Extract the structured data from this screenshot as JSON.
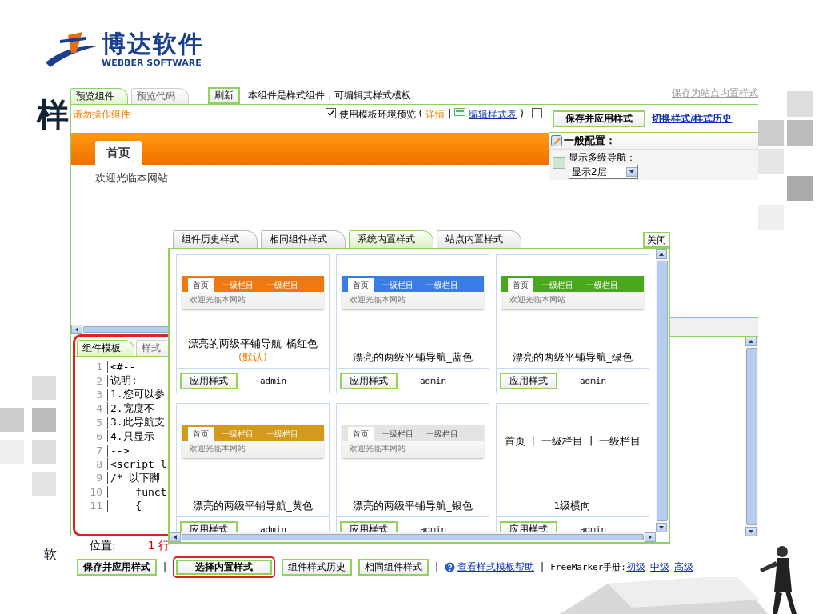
{
  "slide": {
    "logo": {
      "name": "博达软件",
      "subtitle": "WEBBER SOFTWARE"
    },
    "title": "样",
    "footer": "软"
  },
  "editor_window": {
    "tabs": [
      {
        "label": "预览组件",
        "selected": true
      },
      {
        "label": "预览代码",
        "selected": false
      }
    ],
    "refresh": "刷新",
    "notice": "本组件是样式组件，可编辑其样式模板",
    "save_site_link": "保存为站点内置样式",
    "warning": "请勿操作组件",
    "env_preview": {
      "checked": true,
      "label": "使用模板环境预览",
      "paren_open": "(",
      "details": "详情",
      "separator": "|",
      "edit_css": "编辑样式表",
      "paren_close": ")"
    },
    "extra_checkbox": {
      "checked": false
    },
    "save_apply": "保存并应用样式",
    "switch_link": "切换样式/样式历史",
    "preview": {
      "nav_items": [
        {
          "label": "首页",
          "selected": true
        }
      ],
      "welcome": "欢迎光临本网站"
    },
    "config": {
      "title": "一般配置：",
      "field_label": "显示多级导航：",
      "select_value": "显示2层"
    },
    "code_tabs": [
      {
        "label": "组件模板",
        "selected": true
      },
      {
        "label": "样式",
        "selected": false
      }
    ],
    "code_lines": [
      {
        "number": "1",
        "text": "<#--"
      },
      {
        "number": "2",
        "text": "说明:"
      },
      {
        "number": "3",
        "text": "1.您可以参"
      },
      {
        "number": "4",
        "text": "2.宽度不"
      },
      {
        "number": "5",
        "text": "3.此导航支"
      },
      {
        "number": "6",
        "text": "4.只显示"
      },
      {
        "number": "7",
        "text": "-->"
      },
      {
        "number": "8",
        "text": "<script l"
      },
      {
        "number": "9",
        "text": "/* 以下脚"
      },
      {
        "number": "10",
        "text": "    funct"
      },
      {
        "number": "11",
        "text": "    {"
      }
    ],
    "position": {
      "label": "位置:",
      "value": "1 行"
    },
    "toolbar": [
      {
        "kind": "button",
        "label": "保存并应用样式",
        "bold": true,
        "highlighted": false
      },
      {
        "kind": "separator",
        "label": "|"
      },
      {
        "kind": "button",
        "label": "选择内置样式",
        "bold": true,
        "highlighted": true
      },
      {
        "kind": "button",
        "label": "组件样式历史",
        "bold": false,
        "highlighted": false
      },
      {
        "kind": "button",
        "label": "相同组件样式",
        "bold": false,
        "highlighted": false
      },
      {
        "kind": "separator",
        "label": "|"
      },
      {
        "kind": "help",
        "label": "查看样式模板帮助"
      },
      {
        "kind": "separator",
        "label": "|"
      },
      {
        "kind": "text",
        "label": "FreeMarker手册:"
      },
      {
        "kind": "link",
        "label": "初级"
      },
      {
        "kind": "link",
        "label": "中级"
      },
      {
        "kind": "link",
        "label": "高级"
      }
    ]
  },
  "dialog": {
    "tabs": [
      {
        "label": "组件历史样式",
        "selected": false
      },
      {
        "label": "相同组件样式",
        "selected": false
      },
      {
        "label": "系统内置样式",
        "selected": true
      },
      {
        "label": "站点内置样式",
        "selected": false
      }
    ],
    "close": "关闭",
    "cards": [
      {
        "title": "漂亮的两级平铺导航_橘红色",
        "tag": "(默认)",
        "button": "应用样式",
        "author": "admin",
        "preview": {
          "kind": "bar",
          "color": "#f07810",
          "items": [
            "首页",
            "一级栏目",
            "一级栏目"
          ],
          "welcome": "欢迎光临本网站"
        }
      },
      {
        "title": "漂亮的两级平铺导航_蓝色",
        "button": "应用样式",
        "author": "admin",
        "preview": {
          "kind": "bar",
          "color": "#3a7de8",
          "items": [
            "首页",
            "一级栏目",
            "一级栏目"
          ],
          "welcome": "欢迎光临本网站"
        }
      },
      {
        "title": "漂亮的两级平铺导航_绿色",
        "button": "应用样式",
        "author": "admin",
        "preview": {
          "kind": "bar",
          "color": "#4aa81c",
          "items": [
            "首页",
            "一级栏目",
            "一级栏目"
          ],
          "welcome": "欢迎光临本网站"
        }
      },
      {
        "title": "漂亮的两级平铺导航_黄色",
        "button": "应用样式",
        "author": "admin",
        "preview": {
          "kind": "bar",
          "color": "#d49a1c",
          "items": [
            "首页",
            "一级栏目",
            "一级栏目"
          ],
          "welcome": "欢迎光临本网站"
        }
      },
      {
        "title": "漂亮的两级平铺导航_银色",
        "button": "应用样式",
        "author": "admin",
        "preview": {
          "kind": "bar",
          "color": "#e4e4e4",
          "items": [
            "首页",
            "一级栏目",
            "一级栏目"
          ],
          "welcome": "欢迎光临本网站"
        }
      },
      {
        "title": "1级横向",
        "button": "应用样式",
        "author": "admin",
        "preview": {
          "kind": "text",
          "items": [
            "首页",
            "一级栏目",
            "一级栏目"
          ],
          "separator": "|"
        }
      }
    ]
  }
}
